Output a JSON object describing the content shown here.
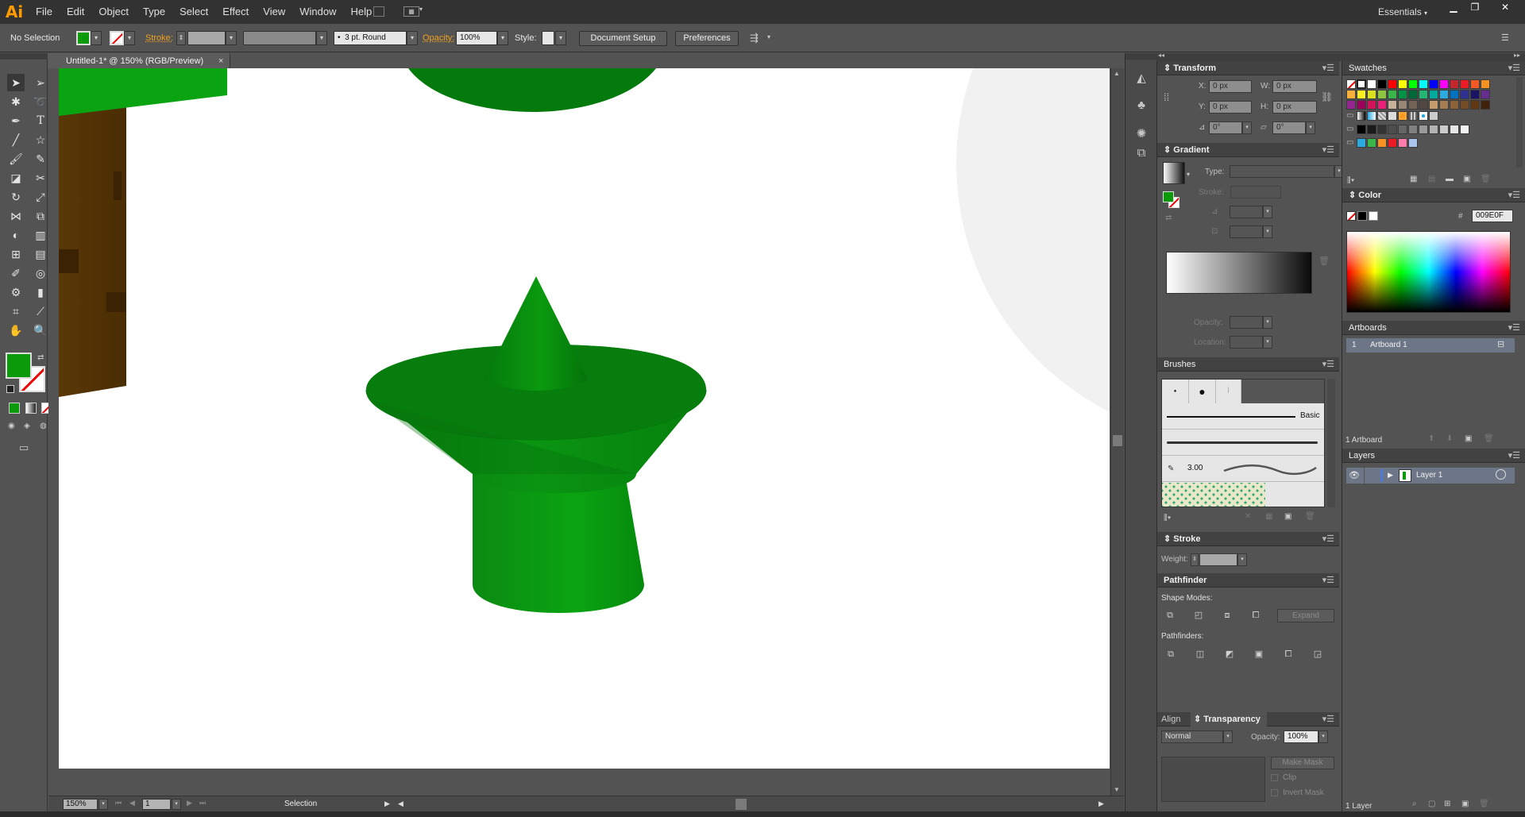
{
  "app": {
    "logo": "Ai",
    "menu": [
      "File",
      "Edit",
      "Object",
      "Type",
      "Select",
      "Effect",
      "View",
      "Window",
      "Help"
    ],
    "workspace": "Essentials",
    "window_controls": [
      "minimize",
      "restore",
      "close"
    ]
  },
  "controlbar": {
    "selection_status": "No Selection",
    "fill_color": "#0a9a0a",
    "stroke_label": "Stroke:",
    "brush_label": "3 pt. Round",
    "opacity_label": "Opacity:",
    "opacity_value": "100%",
    "style_label": "Style:",
    "document_setup": "Document Setup",
    "preferences": "Preferences"
  },
  "document": {
    "tab_title": "Untitled-1* @ 150% (RGB/Preview)",
    "close_glyph": "×"
  },
  "status": {
    "zoom": "150%",
    "artboard_number": "1",
    "tool_name": "Selection"
  },
  "transform": {
    "title": "Transform",
    "x_label": "X:",
    "x_value": "0 px",
    "y_label": "Y:",
    "y_value": "0 px",
    "w_label": "W:",
    "w_value": "0 px",
    "h_label": "H:",
    "h_value": "0 px",
    "rotate_value": "0°",
    "shear_value": "0°"
  },
  "gradient": {
    "title": "Gradient",
    "type_label": "Type:",
    "stroke_label": "Stroke:",
    "opacity_label": "Opacity:",
    "location_label": "Location:"
  },
  "brushes": {
    "title": "Brushes",
    "basic_label": "Basic",
    "size_label": "3.00"
  },
  "stroke": {
    "title": "Stroke",
    "weight_label": "Weight:"
  },
  "pathfinder": {
    "title": "Pathfinder",
    "shape_modes_label": "Shape Modes:",
    "expand_label": "Expand",
    "pathfinders_label": "Pathfinders:"
  },
  "transparency": {
    "tab_align": "Align",
    "tab_transparency": "Transparency",
    "blend_mode": "Normal",
    "opacity_label": "Opacity:",
    "opacity_value": "100%",
    "make_mask": "Make Mask",
    "clip_label": "Clip",
    "invert_mask_label": "Invert Mask"
  },
  "swatches": {
    "title": "Swatches"
  },
  "color": {
    "title": "Color",
    "hash": "#",
    "hex_value": "009E0F"
  },
  "artboards": {
    "title": "Artboards",
    "rows": [
      {
        "index": "1",
        "name": "Artboard 1"
      }
    ],
    "count_label": "1 Artboard"
  },
  "layers": {
    "title": "Layers",
    "rows": [
      {
        "name": "Layer 1"
      }
    ],
    "count_label": "1 Layer"
  },
  "colors": {
    "panel_bg": "#535353",
    "menubar_bg": "#323232",
    "accent_orange": "#ff9a00",
    "green_fill": "#0a9a0a",
    "trunk_brown": "#5a3806",
    "layer_color": "#4a7bd6"
  }
}
